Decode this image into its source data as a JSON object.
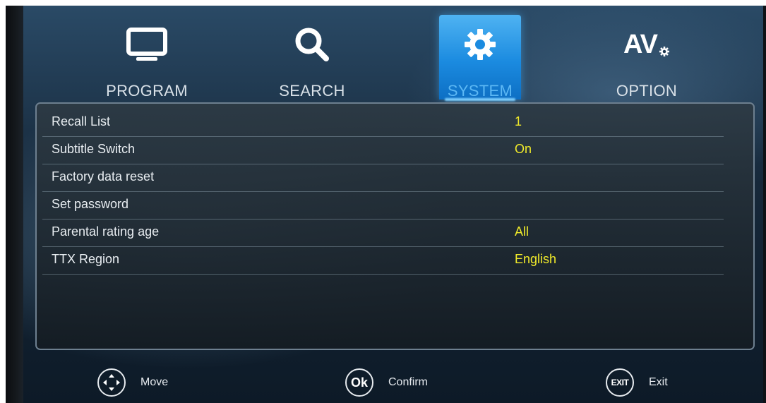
{
  "tabs": [
    {
      "label": "PROGRAM",
      "icon": "tv-icon",
      "active": false
    },
    {
      "label": "SEARCH",
      "icon": "search-icon",
      "active": false
    },
    {
      "label": "SYSTEM",
      "icon": "gear-icon",
      "active": true
    },
    {
      "label": "OPTION",
      "icon": "av-settings-icon",
      "active": false,
      "icon_text": "AV"
    }
  ],
  "settings": [
    {
      "label": "Recall List",
      "value": "1"
    },
    {
      "label": "Subtitle Switch",
      "value": "On"
    },
    {
      "label": "Factory data reset",
      "value": ""
    },
    {
      "label": "Set password",
      "value": ""
    },
    {
      "label": "Parental rating age",
      "value": "All"
    },
    {
      "label": "TTX Region",
      "value": "English"
    }
  ],
  "footer": {
    "move": {
      "label": "Move",
      "icon": "dpad-icon"
    },
    "confirm": {
      "label": "Confirm",
      "icon": "ok-icon",
      "icon_text": "Ok"
    },
    "exit": {
      "label": "Exit",
      "icon": "exit-icon",
      "icon_text": "EXIT"
    }
  },
  "colors": {
    "active_tab": "#1b8be0",
    "value_text": "#f0ea2a",
    "label_text": "#e8edf1"
  }
}
